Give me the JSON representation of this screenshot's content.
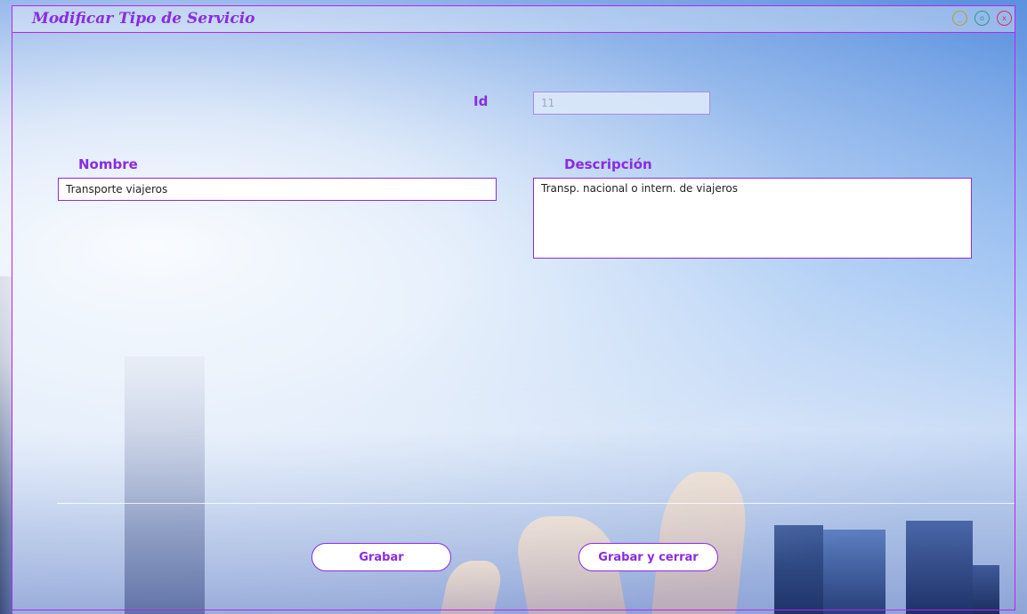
{
  "window": {
    "title": "Modificar Tipo de Servicio",
    "controls": {
      "minimize": "_",
      "maximize": "o",
      "close": "x"
    }
  },
  "form": {
    "id_label": "Id",
    "id_value": "11",
    "nombre_label": "Nombre",
    "nombre_value": "Transporte viajeros",
    "descripcion_label": "Descripción",
    "descripcion_value": "Transp. nacional o intern. de viajeros"
  },
  "actions": {
    "save_label": "Grabar",
    "save_close_label": "Grabar y cerrar"
  },
  "colors": {
    "accent": "#8a2be2",
    "border": "#c020f0"
  }
}
